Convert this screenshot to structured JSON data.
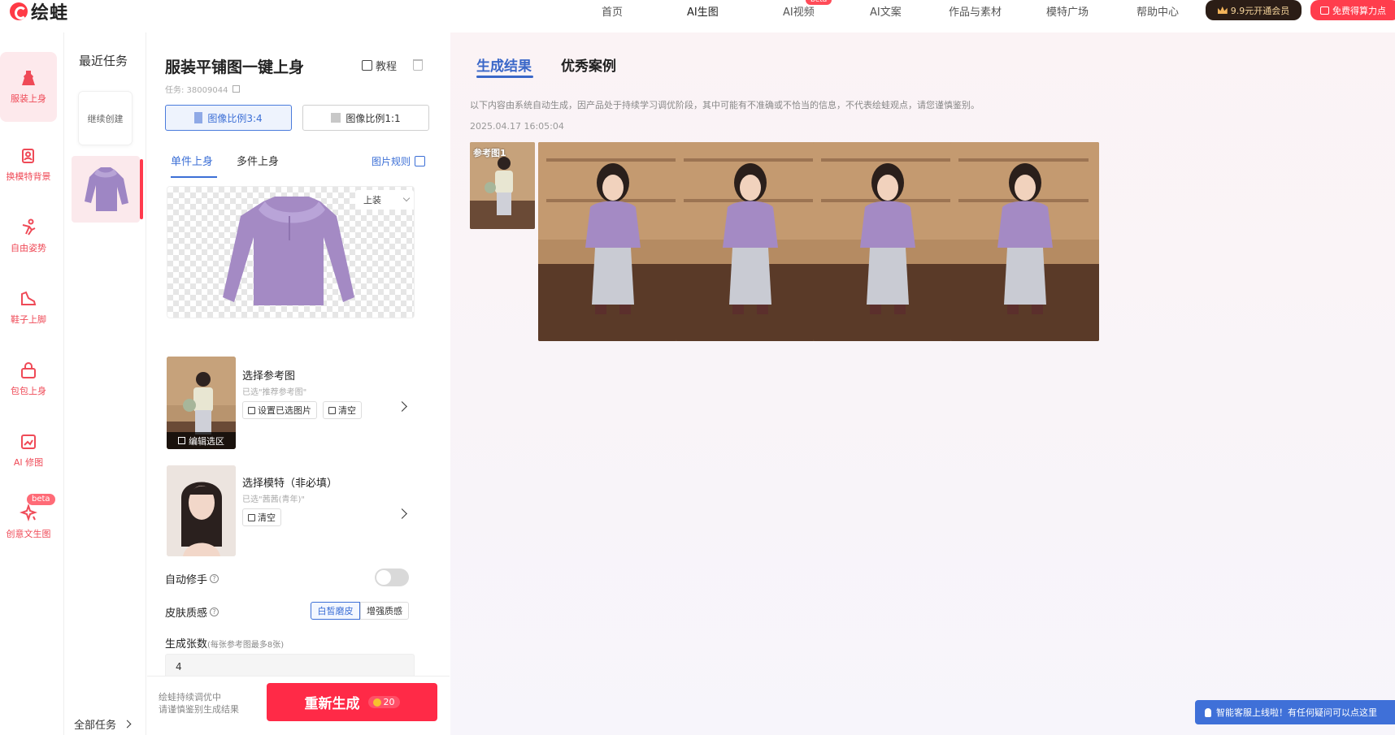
{
  "brand": {
    "name": "绘蛙"
  },
  "nav": {
    "items": [
      {
        "label": "首页",
        "active": false
      },
      {
        "label": "AI生图",
        "active": true
      },
      {
        "label": "AI视频",
        "active": false,
        "badge": "beta"
      },
      {
        "label": "AI文案",
        "active": false
      },
      {
        "label": "作品与素材",
        "active": false
      },
      {
        "label": "模特广场",
        "active": false
      },
      {
        "label": "帮助中心",
        "active": false
      }
    ],
    "vip_label": "9.9元开通会员",
    "free_label": "免费得算力点"
  },
  "rail": {
    "items": [
      {
        "label": "服装上身",
        "icon": "dress-icon",
        "active": true
      },
      {
        "label": "换模特背景",
        "icon": "portrait-swap-icon",
        "active": false
      },
      {
        "label": "自由姿势",
        "icon": "pose-icon",
        "active": false
      },
      {
        "label": "鞋子上脚",
        "icon": "shoe-icon",
        "active": false
      },
      {
        "label": "包包上身",
        "icon": "bag-icon",
        "active": false
      },
      {
        "label": "AI 修图",
        "icon": "retouch-icon",
        "active": false
      },
      {
        "label": "创意文生图",
        "icon": "sparkle-icon",
        "active": false,
        "badge": "beta"
      }
    ]
  },
  "recent": {
    "title": "最近任务",
    "continue_label": "继续创建",
    "all_tasks_label": "全部任务"
  },
  "panel": {
    "title": "服装平铺图一键上身",
    "tutorial_label": "教程",
    "task_id": "任务: 38009044",
    "ratios": [
      {
        "label": "图像比例3:4",
        "selected": true
      },
      {
        "label": "图像比例1:1",
        "selected": false
      }
    ],
    "tabs": [
      {
        "label": "单件上身",
        "active": true
      },
      {
        "label": "多件上身",
        "active": false
      }
    ],
    "image_rules_label": "图片规则",
    "garment_type": "上装",
    "reference": {
      "title": "选择参考图",
      "selected_text": "已选\"推荐参考图\"",
      "set_selected_label": "设置已选图片",
      "clear_label": "清空",
      "edit_selection_label": "编辑选区"
    },
    "model": {
      "title": "选择模特（非必填）",
      "selected_text": "已选\"茜茜(青年)\"",
      "clear_label": "清空"
    },
    "auto_retouch": {
      "label": "自动修手",
      "enabled": false
    },
    "skin": {
      "label": "皮肤质感",
      "options": [
        {
          "label": "白皙磨皮",
          "selected": true
        },
        {
          "label": "增强质感",
          "selected": false
        }
      ]
    },
    "count": {
      "label": "生成张数",
      "hint": "(每张参考图最多8张)",
      "value": "4"
    },
    "footer": {
      "note_line1": "绘蛙持续调优中",
      "note_line2": "请谨慎鉴别生成结果",
      "regen_label": "重新生成",
      "cost": "20"
    }
  },
  "result": {
    "tabs": [
      {
        "label": "生成结果",
        "active": true
      },
      {
        "label": "优秀案例",
        "active": false
      }
    ],
    "disclaimer": "以下内容由系统自动生成，因产品处于持续学习调优阶段，其中可能有不准确或不恰当的信息，不代表绘蛙观点，请您谨慎鉴别。",
    "timestamp": "2025.04.17 16:05:04",
    "reference_label": "参考图1",
    "generated_count": 4
  },
  "chat": {
    "label": "智能客服上线啦！有任何疑问可以点这里"
  },
  "colors": {
    "accent_red": "#ff2a47",
    "accent_blue": "#3c6fd6",
    "top_purple": "#a48ac4"
  }
}
